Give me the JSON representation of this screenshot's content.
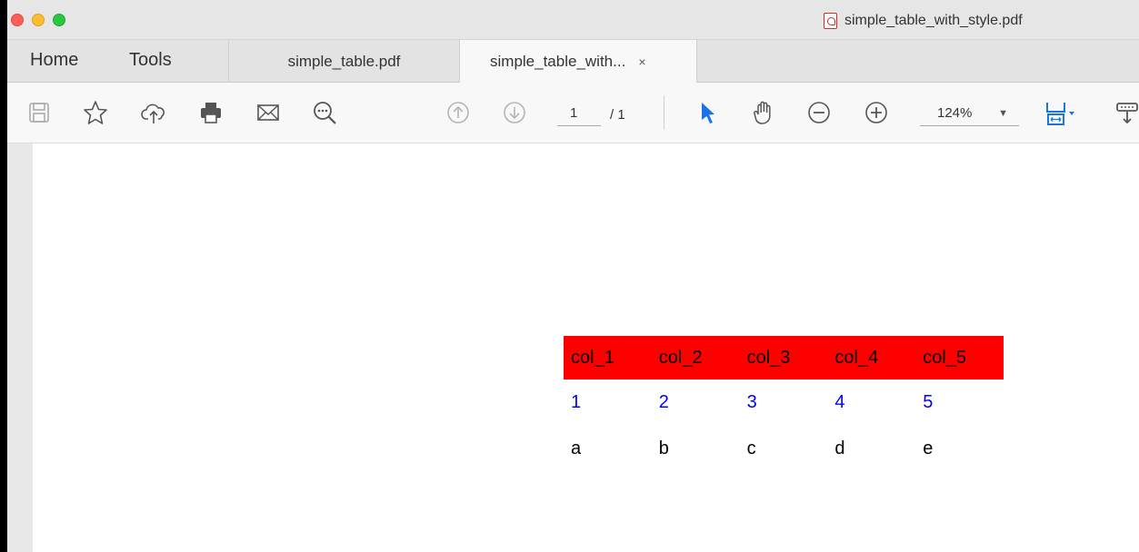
{
  "window": {
    "title": "simple_table_with_style.pdf"
  },
  "nav": {
    "home": "Home",
    "tools": "Tools"
  },
  "tabs": [
    {
      "label": "simple_table.pdf",
      "active": false
    },
    {
      "label": "simple_table_with...",
      "active": true,
      "close": "×"
    }
  ],
  "toolbar": {
    "page_current": "1",
    "page_total": "/ 1",
    "zoom": "124%",
    "zoom_caret": "▼",
    "icons": [
      "save-icon",
      "star-icon",
      "cloud-upload-icon",
      "print-icon",
      "mail-icon",
      "find-icon",
      "prev-page-icon",
      "next-page-icon",
      "select-arrow-icon",
      "hand-icon",
      "zoom-out-icon",
      "zoom-in-icon",
      "fit-page-icon",
      "more-tools-icon"
    ],
    "accent": "#1a73e8"
  },
  "table": {
    "headers": [
      "col_1",
      "col_2",
      "col_3",
      "col_4",
      "col_5"
    ],
    "rows": [
      [
        "1",
        "2",
        "3",
        "4",
        "5"
      ],
      [
        "a",
        "b",
        "c",
        "d",
        "e"
      ]
    ],
    "header_bg": "#ff0000",
    "row1_color": "#0000ff",
    "row2_color": "#000000"
  }
}
